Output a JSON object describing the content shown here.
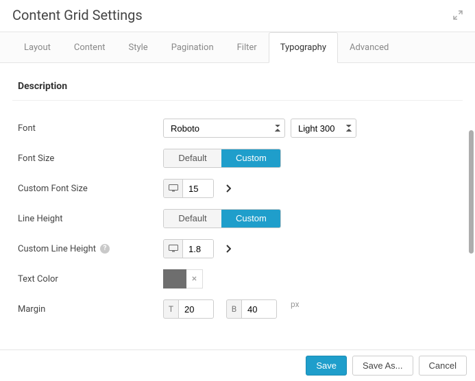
{
  "header": {
    "title": "Content Grid Settings"
  },
  "tabs": [
    "Layout",
    "Content",
    "Style",
    "Pagination",
    "Filter",
    "Typography",
    "Advanced"
  ],
  "active_tab": "Typography",
  "section": {
    "title": "Description"
  },
  "font": {
    "label": "Font",
    "family_value": "Roboto",
    "weight_value": "Light 300"
  },
  "font_size": {
    "label": "Font Size",
    "default_label": "Default",
    "custom_label": "Custom",
    "value": "custom"
  },
  "custom_font_size": {
    "label": "Custom Font Size",
    "value": "15"
  },
  "line_height": {
    "label": "Line Height",
    "default_label": "Default",
    "custom_label": "Custom",
    "value": "custom"
  },
  "custom_line_height": {
    "label": "Custom Line Height",
    "value": "1.8"
  },
  "text_color": {
    "label": "Text Color",
    "value": "#6e6e6e"
  },
  "margin": {
    "label": "Margin",
    "top_addon": "T",
    "top_value": "20",
    "bottom_addon": "B",
    "bottom_value": "40",
    "unit": "px"
  },
  "footer": {
    "save": "Save",
    "save_as": "Save As...",
    "cancel": "Cancel"
  },
  "icons": {
    "help": "?",
    "close": "×"
  }
}
